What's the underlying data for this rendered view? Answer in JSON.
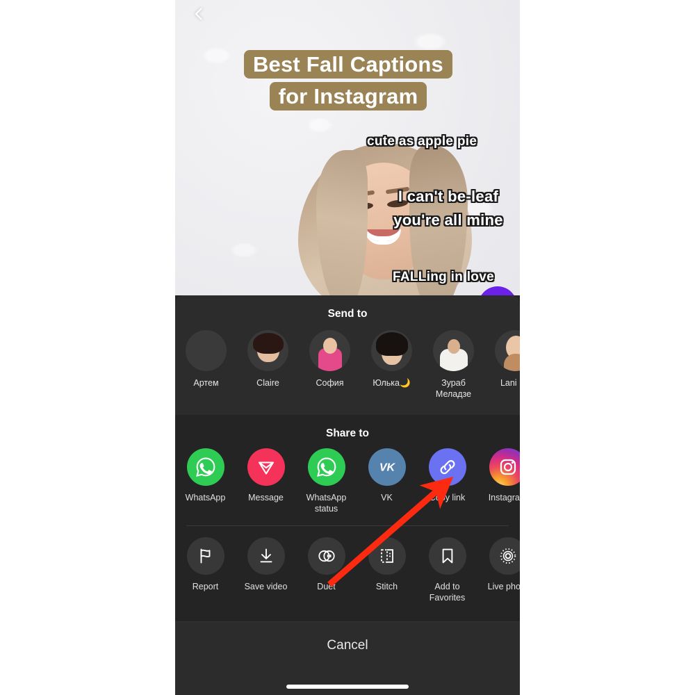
{
  "video": {
    "back_icon": "chevron-left-icon",
    "caption_title": "Best Fall Captions for Instagram",
    "caption_1": "cute as apple pie",
    "caption_2": "I can't be-leaf you're all mine",
    "caption_3": "FALLing in love"
  },
  "share_sheet": {
    "send_to": {
      "title": "Send to",
      "contacts": [
        {
          "name": "Артем",
          "avatar": "blank-avatar"
        },
        {
          "name": "Claire",
          "avatar": "photo-avatar"
        },
        {
          "name": "София",
          "avatar": "photo-avatar"
        },
        {
          "name": "Юлька🌙",
          "avatar": "photo-avatar"
        },
        {
          "name": "Зураб Меладзе",
          "avatar": "photo-avatar"
        },
        {
          "name": "Lani Ra",
          "avatar": "photo-avatar"
        }
      ]
    },
    "share_to": {
      "title": "Share to",
      "apps": [
        {
          "label": "WhatsApp",
          "icon": "whatsapp-icon",
          "color": "#2ecb55"
        },
        {
          "label": "Message",
          "icon": "message-icon",
          "color": "#f5335a"
        },
        {
          "label": "WhatsApp status",
          "icon": "whatsapp-icon",
          "color": "#2ecb55"
        },
        {
          "label": "VK",
          "icon": "vk-icon",
          "color": "#5682ae"
        },
        {
          "label": "Copy link",
          "icon": "link-icon",
          "color": "#6b72f2"
        },
        {
          "label": "Instagram",
          "icon": "instagram-icon",
          "color": "#d62e82"
        }
      ]
    },
    "actions": [
      {
        "label": "Report",
        "icon": "flag-icon"
      },
      {
        "label": "Save video",
        "icon": "download-icon"
      },
      {
        "label": "Duet",
        "icon": "duet-icon"
      },
      {
        "label": "Stitch",
        "icon": "stitch-icon"
      },
      {
        "label": "Add to Favorites",
        "icon": "bookmark-icon"
      },
      {
        "label": "Live photo",
        "icon": "live-photo-icon"
      }
    ],
    "cancel_label": "Cancel"
  },
  "annotation": {
    "arrow_color": "#fc2a10",
    "points_at": "Copy link"
  }
}
